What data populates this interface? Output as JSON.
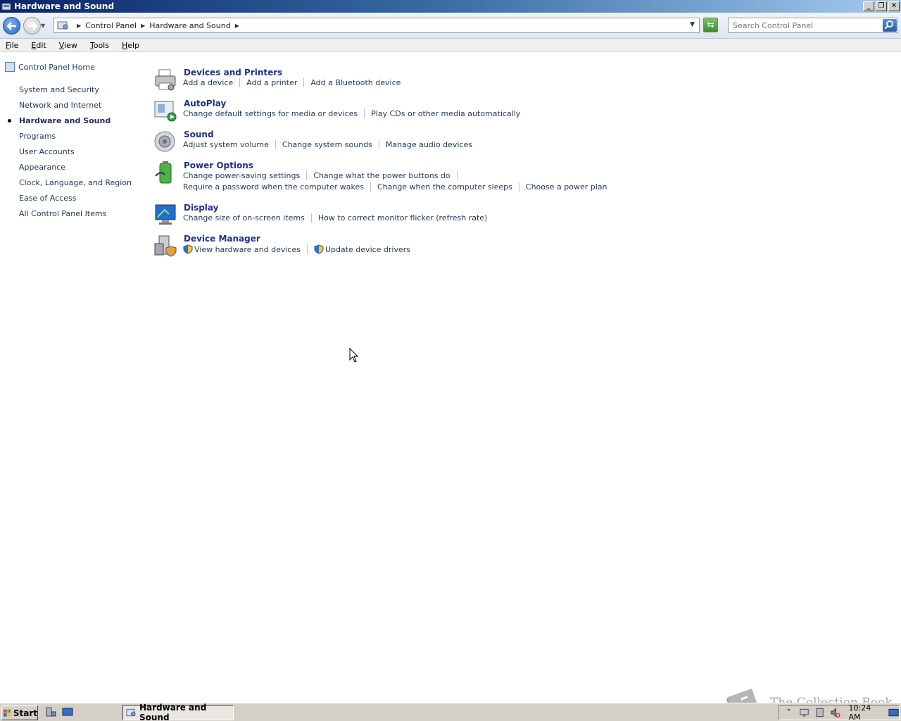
{
  "window": {
    "title": "Hardware and Sound",
    "buttons": {
      "minimize": "_",
      "restore": "❐",
      "close": "✕"
    }
  },
  "address_bar": {
    "breadcrumbs": [
      "Control Panel",
      "Hardware and Sound"
    ],
    "search_placeholder": "Search Control Panel"
  },
  "menu": {
    "items": [
      {
        "label": "File",
        "accel": "F"
      },
      {
        "label": "Edit",
        "accel": "E"
      },
      {
        "label": "View",
        "accel": "V"
      },
      {
        "label": "Tools",
        "accel": "T"
      },
      {
        "label": "Help",
        "accel": "H"
      }
    ]
  },
  "sidebar": {
    "home": "Control Panel Home",
    "items": [
      {
        "label": "System and Security"
      },
      {
        "label": "Network and Internet"
      },
      {
        "label": "Hardware and Sound",
        "active": true
      },
      {
        "label": "Programs"
      },
      {
        "label": "User Accounts"
      },
      {
        "label": "Appearance"
      },
      {
        "label": "Clock, Language, and Region"
      },
      {
        "label": "Ease of Access"
      },
      {
        "label": "All Control Panel Items"
      }
    ]
  },
  "categories": [
    {
      "title": "Devices and Printers",
      "icon": "printer-icon",
      "rows": [
        [
          "Add a device",
          "Add a printer",
          "Add a Bluetooth device"
        ]
      ]
    },
    {
      "title": "AutoPlay",
      "icon": "autoplay-icon",
      "rows": [
        [
          "Change default settings for media or devices",
          "Play CDs or other media automatically"
        ]
      ]
    },
    {
      "title": "Sound",
      "icon": "speaker-icon",
      "rows": [
        [
          "Adjust system volume",
          "Change system sounds",
          "Manage audio devices"
        ]
      ]
    },
    {
      "title": "Power Options",
      "icon": "battery-icon",
      "rows": [
        [
          "Change power-saving settings",
          "Change what the power buttons do"
        ],
        [
          "Require a password when the computer wakes",
          "Change when the computer sleeps",
          "Choose a power plan"
        ]
      ]
    },
    {
      "title": "Display",
      "icon": "monitor-icon",
      "rows": [
        [
          "Change size of on-screen items",
          "How to correct monitor flicker (refresh rate)"
        ]
      ]
    },
    {
      "title": "Device Manager",
      "icon": "device-manager-icon",
      "rows": [
        [
          "View hardware and devices",
          "Update device drivers"
        ]
      ]
    }
  ],
  "taskbar": {
    "start": "Start",
    "task": "Hardware and Sound",
    "clock": "10:24 AM"
  },
  "watermark": "The Collection Book"
}
